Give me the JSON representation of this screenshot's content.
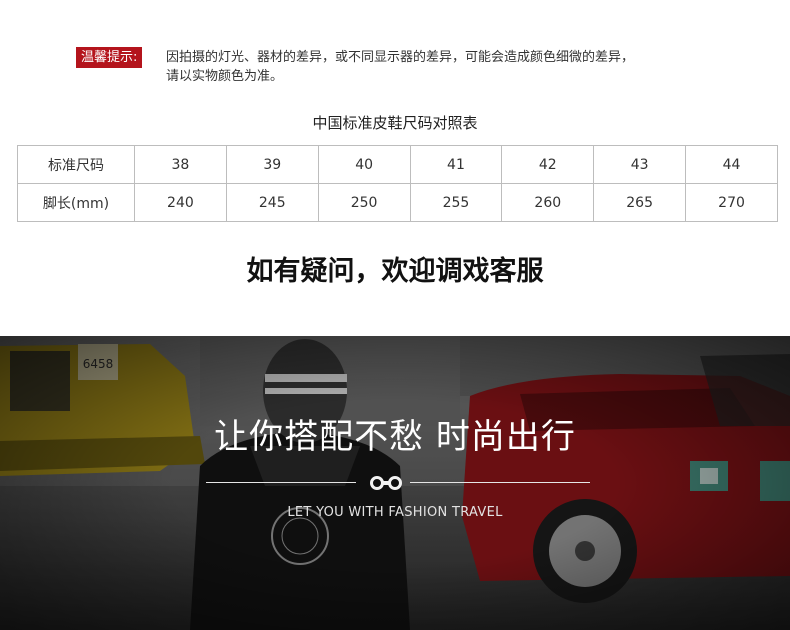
{
  "notice": {
    "badge": "温馨提示:",
    "line1": "因拍摄的灯光、器材的差异，或不同显示器的差异，可能会造成颜色细微的差异，",
    "line2": "请以实物颜色为准。"
  },
  "size_table": {
    "title": "中国标准皮鞋尺码对照表",
    "rows": [
      {
        "label": "标准尺码",
        "values": [
          "38",
          "39",
          "40",
          "41",
          "42",
          "43",
          "44"
        ]
      },
      {
        "label": "脚长(mm)",
        "values": [
          "240",
          "245",
          "250",
          "255",
          "260",
          "265",
          "270"
        ]
      }
    ]
  },
  "question": "如有疑问，欢迎调戏客服",
  "banner": {
    "slogan": "让你搭配不愁 时尚出行",
    "tagline": "LET YOU WITH FASHION TRAVEL",
    "plate_text": "6458"
  },
  "colors": {
    "badge_red": "#b4141c",
    "taxi_red": "#8e1418",
    "taxi_yellow": "#a8911a"
  }
}
